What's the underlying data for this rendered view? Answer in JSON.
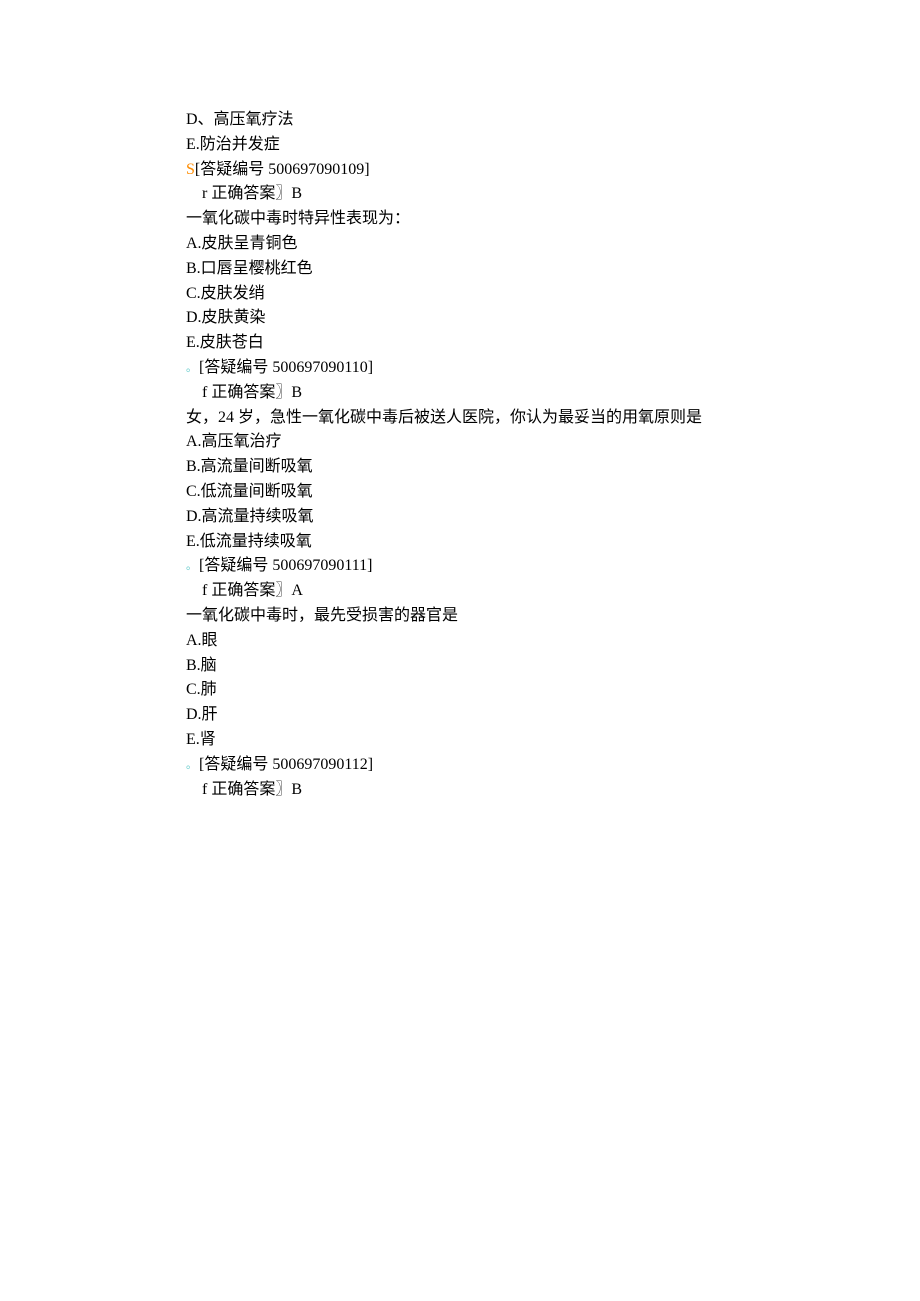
{
  "q1": {
    "optD": "D、高压氧疗法",
    "optE": "E.防治并发症",
    "refPrefix": "S",
    "ref": "[答疑编号 500697090109]",
    "ansPrefix": "r",
    "ansLabel": "正确答案〗",
    "ansValue": "B"
  },
  "q2": {
    "stem": "一氧化碳中毒时特异性表现为：",
    "optA": "A.皮肤呈青铜色",
    "optB": "B.口唇呈樱桃红色",
    "optC": "C.皮肤发绡",
    "optD": "D.皮肤黄染",
    "optE": "E.皮肤苍白",
    "refPrefix": "。",
    "ref": "[答疑编号 500697090110]",
    "ansPrefix": "f",
    "ansLabel": "正确答案〗",
    "ansValue": "B"
  },
  "q3": {
    "stem": "女，24 岁，急性一氧化碳中毒后被送人医院，你认为最妥当的用氧原则是",
    "optA": "A.高压氧治疗",
    "optB": "B.高流量间断吸氧",
    "optC": "C.低流量间断吸氧",
    "optD": "D.高流量持续吸氧",
    "optE": "E.低流量持续吸氧",
    "refPrefix": "。",
    "ref": "[答疑编号 500697090111]",
    "ansPrefix": "f",
    "ansLabel": "正确答案〗",
    "ansValue": "A"
  },
  "q4": {
    "stem": "一氧化碳中毒时，最先受损害的器官是",
    "optA": "A.眼",
    "optB": "B.脑",
    "optC": "C.肺",
    "optD": "D.肝",
    "optE": "E.肾",
    "refPrefix": "。",
    "ref": "[答疑编号 500697090112]",
    "ansPrefix": "f",
    "ansLabel": "正确答案〗",
    "ansValue": "B"
  }
}
